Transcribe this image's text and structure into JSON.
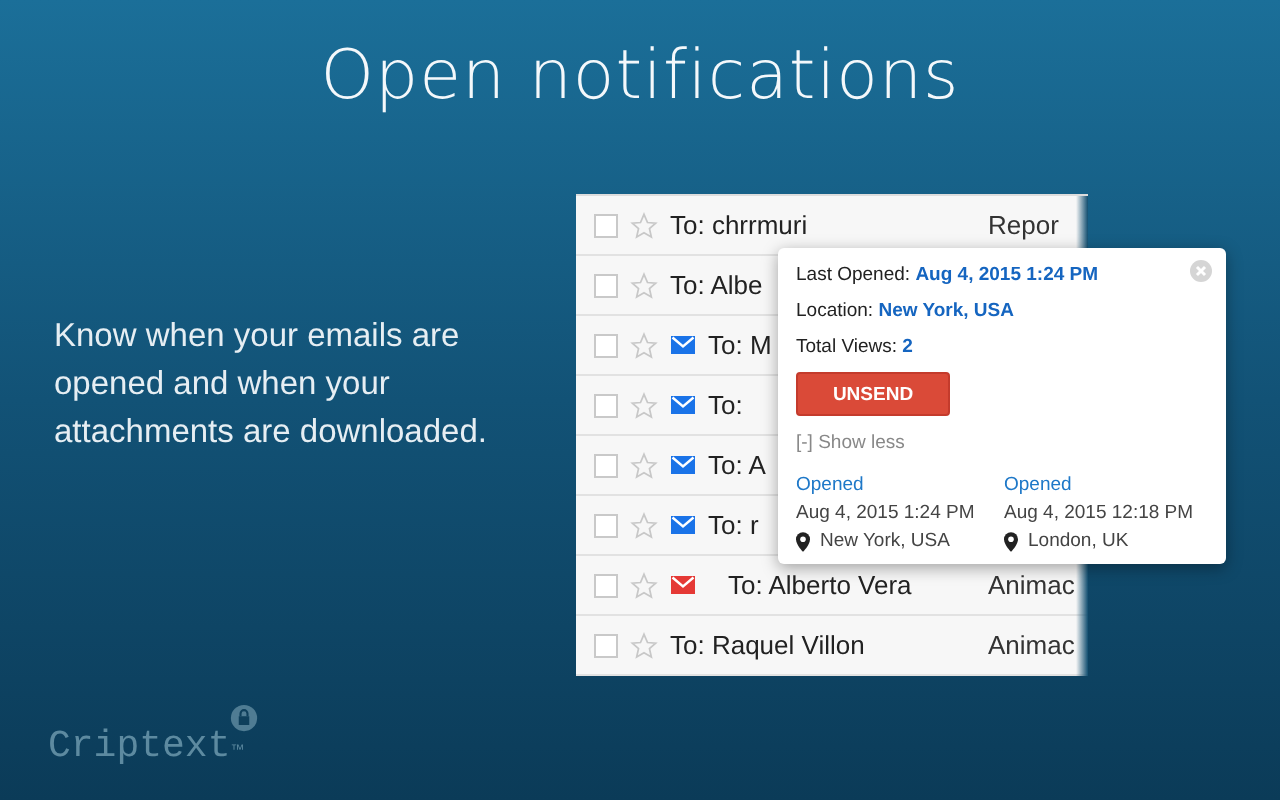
{
  "headline": "Open notifications",
  "description": "Know when your emails are opened and when your attachments are downloaded.",
  "emails": [
    {
      "checked": false,
      "starred": false,
      "recipient": "To: chrrmuri",
      "label": "Repor"
    },
    {
      "checked": false,
      "starred": false,
      "recipient": "To: Albe"
    },
    {
      "checked": false,
      "starred": false,
      "recipient": "To: M",
      "color": "#1a73e8"
    },
    {
      "checked": false,
      "starred": false,
      "recipient": "To:",
      "color": "#1a73e8"
    },
    {
      "checked": false,
      "starred": false,
      "recipient": "To: A",
      "color": "#1a73e8"
    },
    {
      "checked": false,
      "starred": false,
      "recipient": "To: r",
      "color": "#1a73e8"
    },
    {
      "checked": false,
      "starred": false,
      "recipient": "To: Alberto Vera",
      "label": "Animac",
      "color": "#e53935"
    },
    {
      "checked": false,
      "starred": false,
      "recipient": "To: Raquel Villon",
      "label": "Animac"
    }
  ],
  "popup": {
    "fields": [
      {
        "label": "Last Opened:",
        "value": "Aug 4, 2015 1:24 PM"
      },
      {
        "label": "Location:",
        "value": "New York, USA"
      },
      {
        "label": "Total Views:",
        "value": "2"
      }
    ],
    "button": "UNSEND",
    "toggle": "[-] Show less",
    "opens": [
      {
        "status": "Opened",
        "time": "Aug 4, 2015 1:24 PM",
        "location": "New York, USA"
      },
      {
        "status": "Opened",
        "time": "Aug 4, 2015 12:18 PM",
        "location": "London, UK"
      }
    ]
  },
  "brand": {
    "name": "Criptext",
    "mark": "™"
  }
}
